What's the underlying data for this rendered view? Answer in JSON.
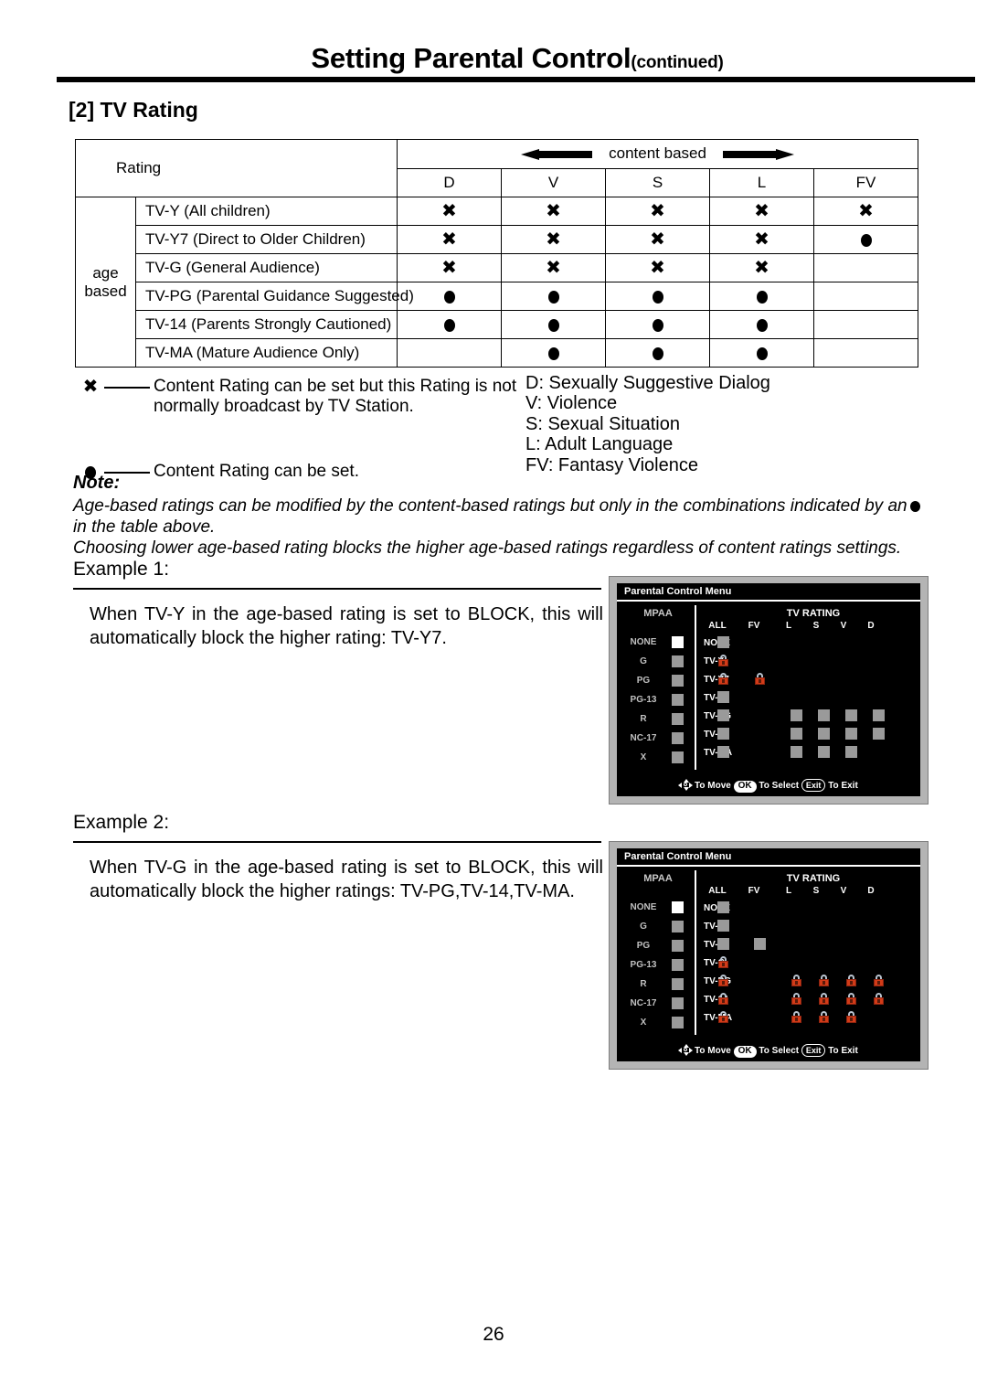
{
  "header": {
    "title_main": "Setting Parental Control",
    "title_suffix": "(continued)",
    "section": "[2] TV Rating"
  },
  "rating_table": {
    "rating_header": "Rating",
    "content_based_label": "content based",
    "age_based_label_line1": "age",
    "age_based_label_line2": "based",
    "columns": [
      "D",
      "V",
      "S",
      "L",
      "FV"
    ],
    "rows": [
      {
        "name": "TV-Y (All children)",
        "marks": [
          "x",
          "x",
          "x",
          "x",
          "x"
        ]
      },
      {
        "name": "TV-Y7 (Direct to Older Children)",
        "marks": [
          "x",
          "x",
          "x",
          "x",
          "dot"
        ]
      },
      {
        "name": "TV-G (General Audience)",
        "marks": [
          "x",
          "x",
          "x",
          "x",
          ""
        ]
      },
      {
        "name": "TV-PG (Parental Guidance Suggested)",
        "marks": [
          "dot",
          "dot",
          "dot",
          "dot",
          ""
        ]
      },
      {
        "name": "TV-14 (Parents Strongly Cautioned)",
        "marks": [
          "dot",
          "dot",
          "dot",
          "dot",
          ""
        ]
      },
      {
        "name": "TV-MA (Mature Audience Only)",
        "marks": [
          "",
          "dot",
          "dot",
          "dot",
          ""
        ]
      }
    ]
  },
  "legend": {
    "x_text_line1": "Content Rating can be set but this Rating is not",
    "x_text_line2": "normally broadcast by TV Station.",
    "dot_text": "Content Rating can be set.",
    "abbreviations": [
      "D: Sexually Suggestive Dialog",
      "V: Violence",
      "S: Sexual Situation",
      "L: Adult  Language",
      "FV: Fantasy Violence"
    ]
  },
  "note": {
    "heading": "Note:",
    "line1_part1": "Age-based ratings can be modified by the content-based ratings but only in the combinations indicated by an",
    "line1_part2": "in the table above.",
    "line2": "Choosing lower age-based rating blocks the higher age-based ratings regardless of content ratings settings."
  },
  "example1": {
    "label": "Example 1:",
    "text": "When TV-Y in the age-based rating is set to BLOCK, this will automatically block the higher rating: TV-Y7."
  },
  "example2": {
    "label": "Example 2:",
    "text": "When TV-G in the age-based rating is set to BLOCK, this will automatically block the higher ratings: TV-PG,TV-14,TV-MA."
  },
  "tv_menu": {
    "title": "Parental Control Menu",
    "mpaa_title": "MPAA",
    "tvrating_title": "TV RATING",
    "mpaa_rows": [
      {
        "label": "NONE",
        "state": "white"
      },
      {
        "label": "G",
        "state": "gray"
      },
      {
        "label": "PG",
        "state": "gray"
      },
      {
        "label": "PG-13",
        "state": "gray"
      },
      {
        "label": "R",
        "state": "gray"
      },
      {
        "label": "NC-17",
        "state": "gray"
      },
      {
        "label": "X",
        "state": "gray"
      }
    ],
    "columns": [
      "ALL",
      "FV",
      "L",
      "S",
      "V",
      "D"
    ],
    "hint_move": "To Move",
    "hint_ok": "OK",
    "hint_select": "To Select",
    "hint_exit_key": "Exit",
    "hint_exit": "To Exit",
    "example1_grid": [
      {
        "label": "NONE",
        "cells": [
          "box",
          "",
          "",
          "",
          "",
          ""
        ]
      },
      {
        "label": "TV-Y",
        "cells": [
          "lock",
          "",
          "",
          "",
          "",
          ""
        ]
      },
      {
        "label": "TV-Y7",
        "cells": [
          "lock",
          "lock",
          "",
          "",
          "",
          ""
        ]
      },
      {
        "label": "TV-G",
        "cells": [
          "box",
          "",
          "",
          "",
          "",
          ""
        ]
      },
      {
        "label": "TV-PG",
        "cells": [
          "box",
          "",
          "box",
          "box",
          "box",
          "box"
        ]
      },
      {
        "label": "TV-14",
        "cells": [
          "box",
          "",
          "box",
          "box",
          "box",
          "box"
        ]
      },
      {
        "label": "TV-MA",
        "cells": [
          "box",
          "",
          "box",
          "box",
          "box",
          ""
        ]
      }
    ],
    "example2_grid": [
      {
        "label": "NONE",
        "cells": [
          "box",
          "",
          "",
          "",
          "",
          ""
        ]
      },
      {
        "label": "TV-Y",
        "cells": [
          "box",
          "",
          "",
          "",
          "",
          ""
        ]
      },
      {
        "label": "TV-Y7",
        "cells": [
          "box",
          "box",
          "",
          "",
          "",
          ""
        ]
      },
      {
        "label": "TV-G",
        "cells": [
          "lock",
          "",
          "",
          "",
          "",
          ""
        ]
      },
      {
        "label": "TV-PG",
        "cells": [
          "lock",
          "",
          "lock",
          "lock",
          "lock",
          "lock"
        ]
      },
      {
        "label": "TV-14",
        "cells": [
          "lock",
          "",
          "lock",
          "lock",
          "lock",
          "lock"
        ]
      },
      {
        "label": "TV-MA",
        "cells": [
          "lock",
          "",
          "lock",
          "lock",
          "lock",
          ""
        ]
      }
    ]
  },
  "footer": {
    "page_number": "26"
  },
  "colors": {
    "lock_body": "#d23b18",
    "box_gray": "#9a9a9a",
    "box_selected": "#ffffff",
    "bezel": "#b4b4b4",
    "screen": "#000000"
  }
}
